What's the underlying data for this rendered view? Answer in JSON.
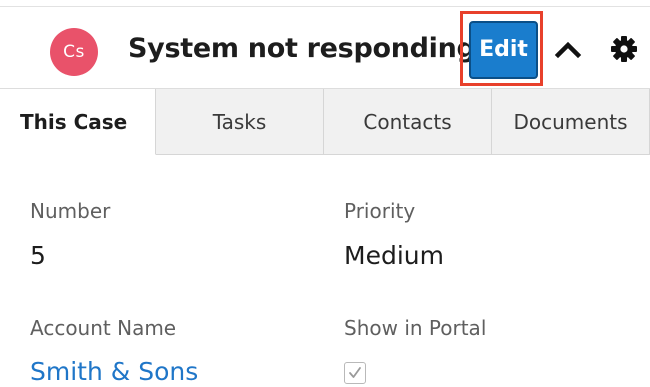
{
  "header": {
    "avatar_initials": "Cs",
    "avatar_color": "#e9526a",
    "title": "System not responding",
    "edit_label": "Edit",
    "edit_highlighted": true,
    "collapse_icon": "chevron-up-icon",
    "settings_icon": "gear-icon"
  },
  "tabs": [
    {
      "label": "This Case",
      "active": true
    },
    {
      "label": "Tasks",
      "active": false
    },
    {
      "label": "Contacts",
      "active": false
    },
    {
      "label": "Documents",
      "active": false
    }
  ],
  "fields": {
    "number": {
      "label": "Number",
      "value": "5"
    },
    "priority": {
      "label": "Priority",
      "value": "Medium"
    },
    "account_name": {
      "label": "Account Name",
      "value": "Smith & Sons"
    },
    "show_in_portal": {
      "label": "Show in Portal",
      "checked": true
    }
  },
  "colors": {
    "accent": "#1a7dcd",
    "highlight_border": "#e8402b",
    "link": "#1f76c8"
  }
}
